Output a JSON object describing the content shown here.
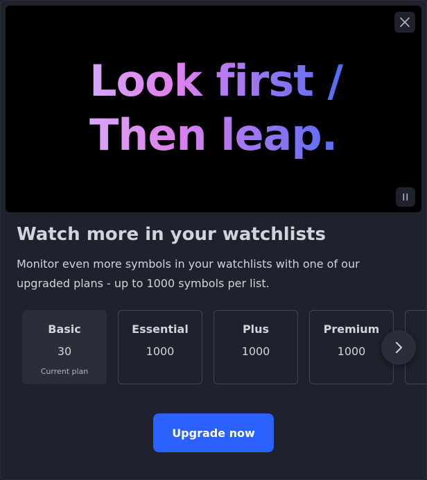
{
  "hero": {
    "line1": "Look first /",
    "line2": "Then leap."
  },
  "icons": {
    "close": "close-icon",
    "pause": "pause-icon",
    "next": "chevron-right-icon"
  },
  "dialog": {
    "title": "Watch more in your watchlists",
    "description": "Monitor even more symbols in your watchlists with one of our upgraded plans - up to 1000 symbols per list."
  },
  "plans": [
    {
      "name": "Basic",
      "count": "30",
      "note": "Current plan"
    },
    {
      "name": "Essential",
      "count": "1000",
      "note": ""
    },
    {
      "name": "Plus",
      "count": "1000",
      "note": ""
    },
    {
      "name": "Premium",
      "count": "1000",
      "note": ""
    }
  ],
  "actions": {
    "upgrade_label": "Upgrade now"
  },
  "colors": {
    "accent": "#2962ff",
    "background": "#1e222d",
    "card_current": "#2a2e39"
  }
}
